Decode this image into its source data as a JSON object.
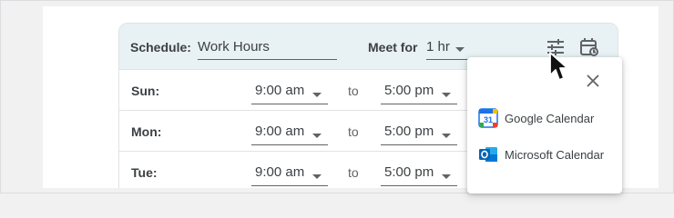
{
  "header": {
    "schedule_label": "Schedule:",
    "schedule_value": "Work Hours",
    "meet_label": "Meet for",
    "meet_value": "1 hr"
  },
  "rows": [
    {
      "day": "Sun:",
      "start": "9:00 am",
      "to": "to",
      "end": "5:00 pm"
    },
    {
      "day": "Mon:",
      "start": "9:00 am",
      "to": "to",
      "end": "5:00 pm"
    },
    {
      "day": "Tue:",
      "start": "9:00 am",
      "to": "to",
      "end": "5:00 pm"
    }
  ],
  "popup": {
    "options": [
      {
        "label": "Google Calendar",
        "icon": "google-calendar-icon"
      },
      {
        "label": "Microsoft Calendar",
        "icon": "outlook-icon"
      }
    ]
  },
  "icons": {
    "tune": "tune-icon",
    "calendar_sync": "calendar-sync-icon",
    "close": "close-icon",
    "cursor": "mouse-cursor-icon"
  },
  "colors": {
    "header_bg": "#e8f1f3",
    "google_blue": "#1a73e8",
    "outlook_blue": "#0364b8",
    "text": "#3c4043"
  }
}
